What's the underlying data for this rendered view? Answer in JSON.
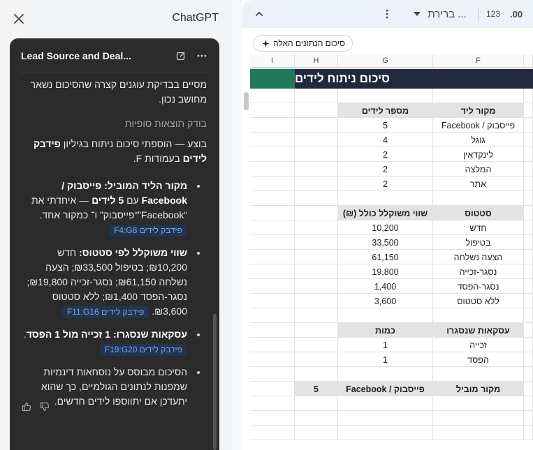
{
  "panel": {
    "app_title": "ChatGPT",
    "card_title": "Lead Source and Deal...",
    "intro": "מסיים בבדיקת עוגנים קצרה שהסיכום נשאר מחושב נכון.",
    "status": "בודק תוצאות סופיות",
    "done_prefix": "בוצע — הוספתי סיכום ניתוח בגיליון ",
    "done_bold": "פידבק לידים",
    "done_suffix": " בעמודות F.",
    "bullets": [
      {
        "bold": "מקור הליד המוביל: פייסבוק / Facebook",
        "mid": " עם ",
        "bold2": "5 לידים",
        "text": " — איחדתי את “Facebook”“פייסבוק” ו־ כמקור אחד.",
        "chip": "פידבק לידים F4:G8"
      },
      {
        "bold": "שווי משוקלל לפי סטטוס:",
        "text": " חדש ₪10,200; בטיפול ₪33,500; הצעה נשלחה ₪61,150; נסגר-זכייה ₪19,800; נסגר-הפסד ₪1,400; ללא סטטוס ₪3,600.",
        "chip": "פידבק לידים F11:G16"
      },
      {
        "bold": "עסקאות שנסגרו: 1 זכייה מול 1 הפסד",
        "text": ".",
        "chip": "פידבק לידים F19:G20"
      },
      {
        "bold": "",
        "text": "הסיכום מבוסס על נוסחאות דינמיות שמפנות לנתונים הגולמיים, כך שהוא יתעדכן אם יתווספו לידים חדשים.",
        "chip": ""
      }
    ]
  },
  "toolbar": {
    "font_label": "ברירת ...",
    "format_label": "123",
    "decimal_label": ".00"
  },
  "summarize_chip": "סיכום הנתונים האלה",
  "columns": [
    "I",
    "H",
    "G",
    "F"
  ],
  "sheet": {
    "title": "סיכום ניתוח לידים",
    "source_header": [
      "מקור ליד",
      "מספר לידים"
    ],
    "sources": [
      [
        "פייסבוק / Facebook",
        "5"
      ],
      [
        "גוגל",
        "4"
      ],
      [
        "לינקדאין",
        "2"
      ],
      [
        "המלצה",
        "2"
      ],
      [
        "אתר",
        "2"
      ]
    ],
    "status_header": [
      "סטטוס",
      "שווי משוקלל כולל (₪)"
    ],
    "statuses": [
      [
        "חדש",
        "10,200"
      ],
      [
        "בטיפול",
        "33,500"
      ],
      [
        "הצעה נשלחה",
        "61,150"
      ],
      [
        "נסגר-זכייה",
        "19,800"
      ],
      [
        "נסגר-הפסד",
        "1,400"
      ],
      [
        "ללא סטטוס",
        "3,600"
      ]
    ],
    "closed_header": [
      "עסקאות שנסגרו",
      "כמות"
    ],
    "closed": [
      [
        "זכייה",
        "1"
      ],
      [
        "הפסד",
        "1"
      ]
    ],
    "leading": [
      "מקור מוביל",
      "פייסבוק / Facebook",
      "5"
    ]
  },
  "colors": {
    "title_band": "#1f2a3c",
    "accent": "#1f7a5a",
    "header_fill": "#e3e3e3"
  }
}
